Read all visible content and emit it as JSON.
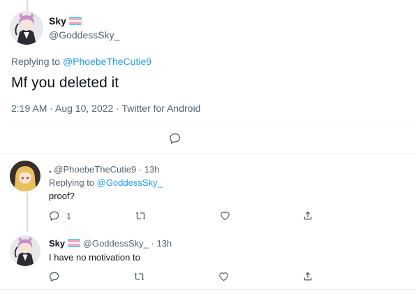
{
  "main_tweet": {
    "display_name": "Sky",
    "handle": "@GoddessSky_",
    "replying_to_prefix": "Replying to",
    "replying_to_handle": "@PhoebeTheCutie9",
    "text": "Mf you deleted it",
    "timestamp": "2:19 AM · Aug 10, 2022 · Twitter for Android"
  },
  "replies": [
    {
      "display_name": ".",
      "handle": "@PhoebeTheCutie9",
      "time": "· 13h",
      "replying_to_prefix": "Replying to",
      "replying_to_handle": "@GoddessSky_",
      "text": "proof?",
      "reply_count": "1"
    },
    {
      "display_name": "Sky",
      "handle": "@GoddessSky_",
      "time": "· 13h",
      "text": "I have no motivation to"
    }
  ],
  "colors": {
    "accent": "#1d9bf0",
    "muted": "#536471",
    "trans_flag": [
      "#5bcefa",
      "#f5a9b8",
      "#ffffff",
      "#f5a9b8",
      "#5bcefa"
    ]
  },
  "icons": [
    "reply-icon",
    "retweet-icon",
    "like-icon",
    "share-icon"
  ]
}
